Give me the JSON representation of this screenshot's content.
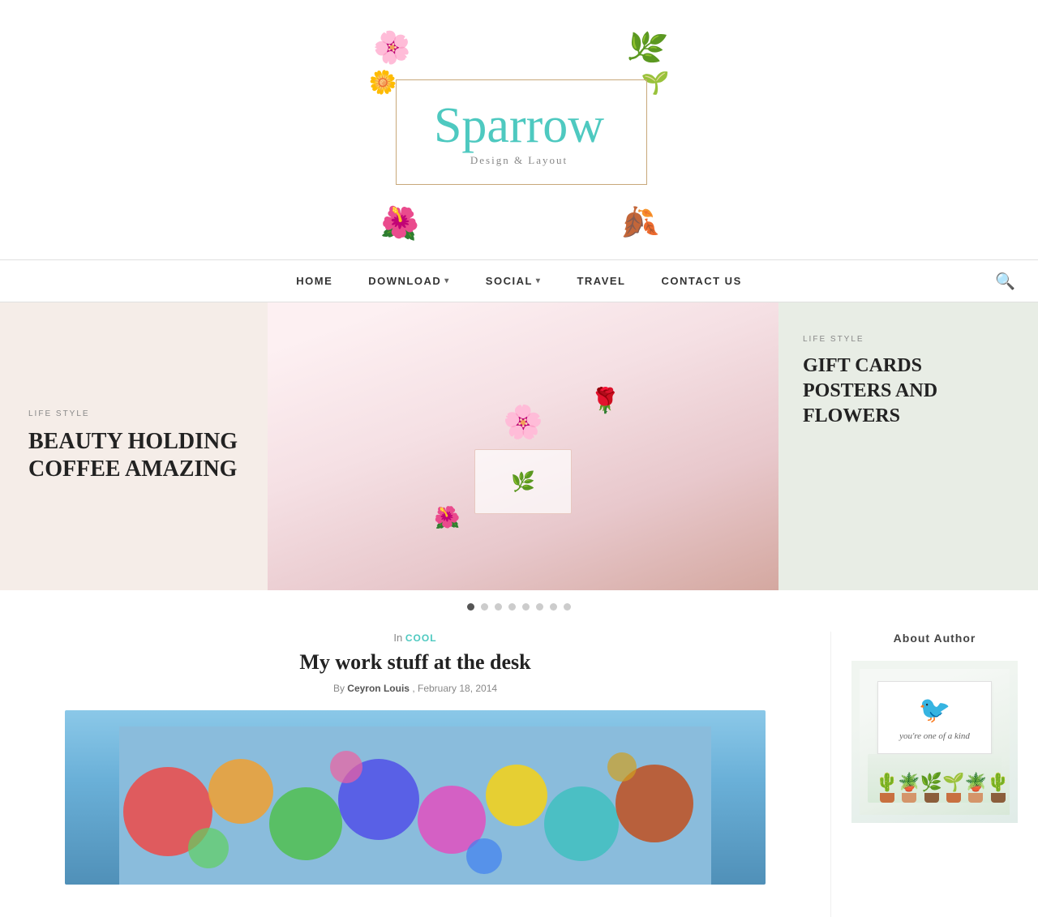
{
  "site": {
    "title": "Sparrow",
    "subtitle": "Design & Layout",
    "logo_floral_tl": "🌸",
    "logo_floral_tr": "🌿",
    "logo_floral_bl": "🌺",
    "logo_floral_br": "🍂",
    "logo_floral_ml": "🌼",
    "logo_floral_mr": "🌱"
  },
  "nav": {
    "items": [
      {
        "label": "HOME",
        "has_dropdown": false
      },
      {
        "label": "DOWNLOAD",
        "has_dropdown": true
      },
      {
        "label": "SOCIAL",
        "has_dropdown": true
      },
      {
        "label": "TRAVEL",
        "has_dropdown": false
      },
      {
        "label": "CONTACT US",
        "has_dropdown": false
      }
    ],
    "search_icon": "🔍"
  },
  "slider": {
    "left_panel": {
      "category": "LIFE STYLE",
      "title": "BEAUTY HOLDING COFFEE AMAZING"
    },
    "right_panel": {
      "category": "LIFE STYLE",
      "title": "GIFT CARDS POSTERS AND FLOWERS"
    },
    "dots": [
      1,
      2,
      3,
      4,
      5,
      6,
      7,
      8
    ],
    "active_dot": 0
  },
  "main_post": {
    "in_label": "In",
    "category": "COOL",
    "title": "My work stuff at the desk",
    "by_label": "By",
    "author": "Ceyron Louis",
    "date": "February 18, 2014"
  },
  "sidebar": {
    "title": "About Author",
    "card_text": "you're one of a kind",
    "plants_emoji": [
      "🌵",
      "🪴",
      "🌿",
      "🌱",
      "🪴",
      "🌵"
    ]
  }
}
